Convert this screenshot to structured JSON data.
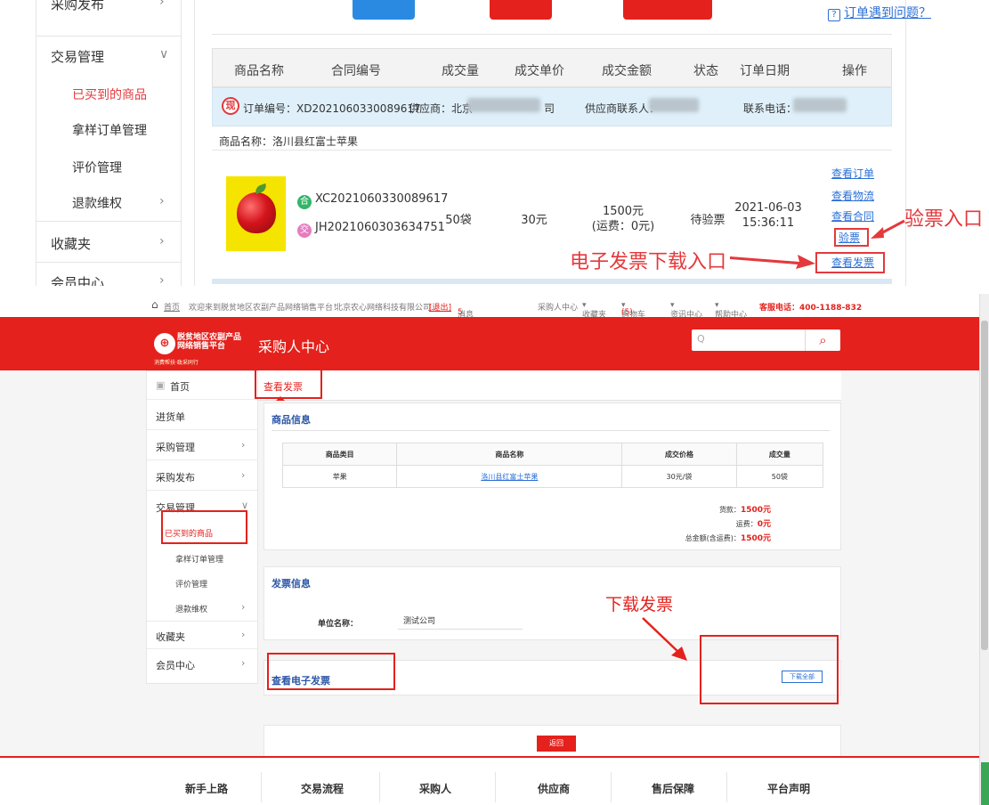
{
  "top": {
    "sidebar": {
      "purchase_publish": "采购发布",
      "trade_mgmt": "交易管理",
      "sub_items": [
        "已买到的商品",
        "拿样订单管理",
        "评价管理",
        "退款维权"
      ],
      "favorites": "收藏夹",
      "member_center": "会员中心"
    },
    "help_link": "订单遇到问题？",
    "columns": [
      "商品名称",
      "合同编号",
      "成交量",
      "成交单价",
      "成交金额",
      "状态",
      "订单日期",
      "操作"
    ],
    "order": {
      "badge": "现",
      "order_no": "订单编号：XD2021060330089617",
      "supplier_label": "供应商：北京",
      "supplier_suffix": "司",
      "contact_label": "供应商联系人：",
      "phone_label": "联系电话："
    },
    "product_name_line": "商品名称：洛川县红富士苹果",
    "item": {
      "contract_badge": "合",
      "contract_no": "XC2021060330089617",
      "trade_badge": "交",
      "trade_no": "JH2021060303634751",
      "quantity": "50袋",
      "unit_price": "30元",
      "amount": "1500元",
      "freight": "(运费：0元)",
      "status": "待验票",
      "date": "2021-06-03",
      "time": "15:36:11"
    },
    "ops": [
      "查看订单",
      "查看物流",
      "查看合同",
      "验票",
      "查看发票"
    ],
    "annotations": {
      "verify_entry": "验票入口",
      "invoice_download_entry": "电子发票下载入口"
    }
  },
  "bottom": {
    "topbar": {
      "home": "首页",
      "welcome": "欢迎来到脱贫地区农副产品网络销售平台！",
      "company": "北京农心网络科技有限公司...",
      "logout": "[退出]",
      "messages": "消息",
      "message_count": "5",
      "buyer_center": "采购人中心",
      "favorites": "收藏夹",
      "cart": "购物车",
      "cart_count": "(5)",
      "info_center": "资讯中心",
      "help_center": "帮助中心",
      "hotline": "客服电话：400-1188-832"
    },
    "header": {
      "logo_line1": "脱贫地区农副产品",
      "logo_line2": "网络销售平台",
      "logo_sub": "消费帮扶·政采同行",
      "title": "采购人中心",
      "search_placeholder": "Q"
    },
    "sidebar": {
      "home": "首页",
      "stock_list": "进货单",
      "purchase_mgmt": "采购管理",
      "purchase_publish": "采购发布",
      "trade_mgmt": "交易管理",
      "sub_items": [
        "已买到的商品",
        "拿样订单管理",
        "评价管理",
        "退款维权"
      ],
      "favorites": "收藏夹",
      "member_center": "会员中心"
    },
    "tab": "查看发票",
    "goods_info": {
      "title": "商品信息",
      "headers": [
        "商品类目",
        "商品名称",
        "成交价格",
        "成交量"
      ],
      "row": [
        "苹果",
        "洛川县红富士苹果",
        "30元/袋",
        "50袋"
      ],
      "payment_label": "货款：",
      "payment_value": "1500元",
      "freight_label": "运费：",
      "freight_value": "0元",
      "total_label": "总金额(含运费)：",
      "total_value": "1500元"
    },
    "invoice_info": {
      "title": "发票信息",
      "unit_label": "单位名称：",
      "unit_value": "测试公司"
    },
    "e_invoice": {
      "title": "查看电子发票",
      "download_all": "下载全部"
    },
    "back": "返回",
    "annotation": "下载发票",
    "footer": [
      "新手上路",
      "交易流程",
      "采购人",
      "供应商",
      "售后保障",
      "平台声明"
    ]
  }
}
